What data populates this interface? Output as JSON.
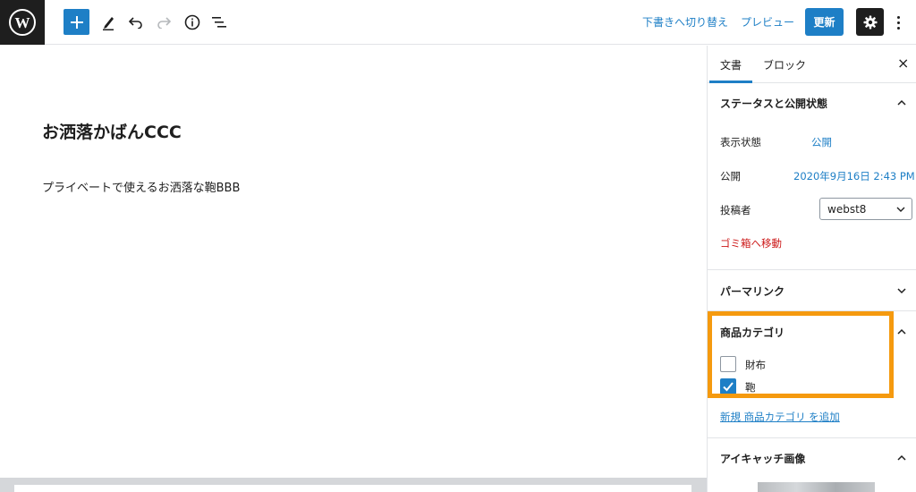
{
  "toolbar": {
    "switch_draft_label": "下書きへ切り替え",
    "preview_label": "プレビュー",
    "update_label": "更新"
  },
  "post": {
    "title": "お洒落かばんCCC",
    "body": "プライベートで使えるお洒落な鞄BBB"
  },
  "sidebar": {
    "tabs": [
      {
        "label": "文書",
        "active": true
      },
      {
        "label": "ブロック",
        "active": false
      }
    ],
    "close_glyph": "×",
    "status_panel": {
      "title": "ステータスと公開状態",
      "visibility_label": "表示状態",
      "visibility_value": "公開",
      "publish_label": "公開",
      "publish_value": "2020年9月16日 2:43 PM",
      "author_label": "投稿者",
      "author_value": "webst8",
      "trash_label": "ゴミ箱へ移動"
    },
    "permalink_panel": {
      "title": "パーマリンク"
    },
    "category_panel": {
      "title": "商品カテゴリ",
      "items": [
        {
          "label": "財布",
          "checked": false
        },
        {
          "label": "鞄",
          "checked": true
        }
      ],
      "add_new_label": "新規 商品カテゴリ を追加"
    },
    "featured_image_panel": {
      "title": "アイキャッチ画像"
    }
  },
  "colors": {
    "accent": "#1e7fc6",
    "highlight": "#f59a0f",
    "danger": "#cc1818",
    "dark": "#1e1e1e"
  },
  "icons": [
    "wordpress-logo-icon",
    "plus-icon",
    "pencil-icon",
    "undo-icon",
    "redo-icon",
    "info-icon",
    "list-view-icon",
    "gear-icon",
    "more-vertical-icon",
    "close-icon",
    "chevron-up-icon",
    "chevron-down-icon",
    "checkmark-icon"
  ]
}
